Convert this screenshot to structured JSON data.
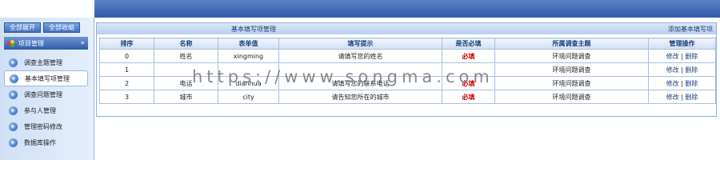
{
  "sidebar": {
    "expand_all": "全部展开",
    "collapse_all": "全部收缩",
    "section_title": "项目管理",
    "section_arrows": "»",
    "items": [
      {
        "label": "调查主题管理",
        "active": false
      },
      {
        "label": "基本填写项管理",
        "active": true
      },
      {
        "label": "调查问题管理",
        "active": false
      },
      {
        "label": "参与人管理",
        "active": false
      },
      {
        "label": "管理密码修改",
        "active": false
      },
      {
        "label": "数据库操作",
        "active": false
      }
    ]
  },
  "panel": {
    "title": "基本填写项管理",
    "add_link": "添加基本填写项"
  },
  "table": {
    "headers": [
      "排序",
      "名称",
      "表单值",
      "填写提示",
      "是否必填",
      "所属调查主题",
      "管理操作"
    ],
    "rows": [
      {
        "order": "0",
        "name": "姓名",
        "value": "xingming",
        "hint": "请填写您的姓名",
        "required": "必填",
        "topic": "环境问题调查",
        "edit": "修改",
        "sep": "|",
        "del": "删除"
      },
      {
        "order": "1",
        "name": "",
        "value": "",
        "hint": "",
        "required": "",
        "topic": "环境问题调查",
        "edit": "修改",
        "sep": "|",
        "del": "删除"
      },
      {
        "order": "2",
        "name": "电话",
        "value": "dianhua",
        "hint": "请填写您的联系电话",
        "required": "必填",
        "topic": "环境问题调查",
        "edit": "修改",
        "sep": "|",
        "del": "删除"
      },
      {
        "order": "3",
        "name": "城市",
        "value": "city",
        "hint": "请告知您所在的城市",
        "required": "必填",
        "topic": "环境问题调查",
        "edit": "修改",
        "sep": "|",
        "del": "删除"
      }
    ]
  },
  "watermark": "https://www.songma.com",
  "colors": {
    "banner": "#2f5ca8",
    "required": "#d40000",
    "link": "#1a3f7a"
  }
}
